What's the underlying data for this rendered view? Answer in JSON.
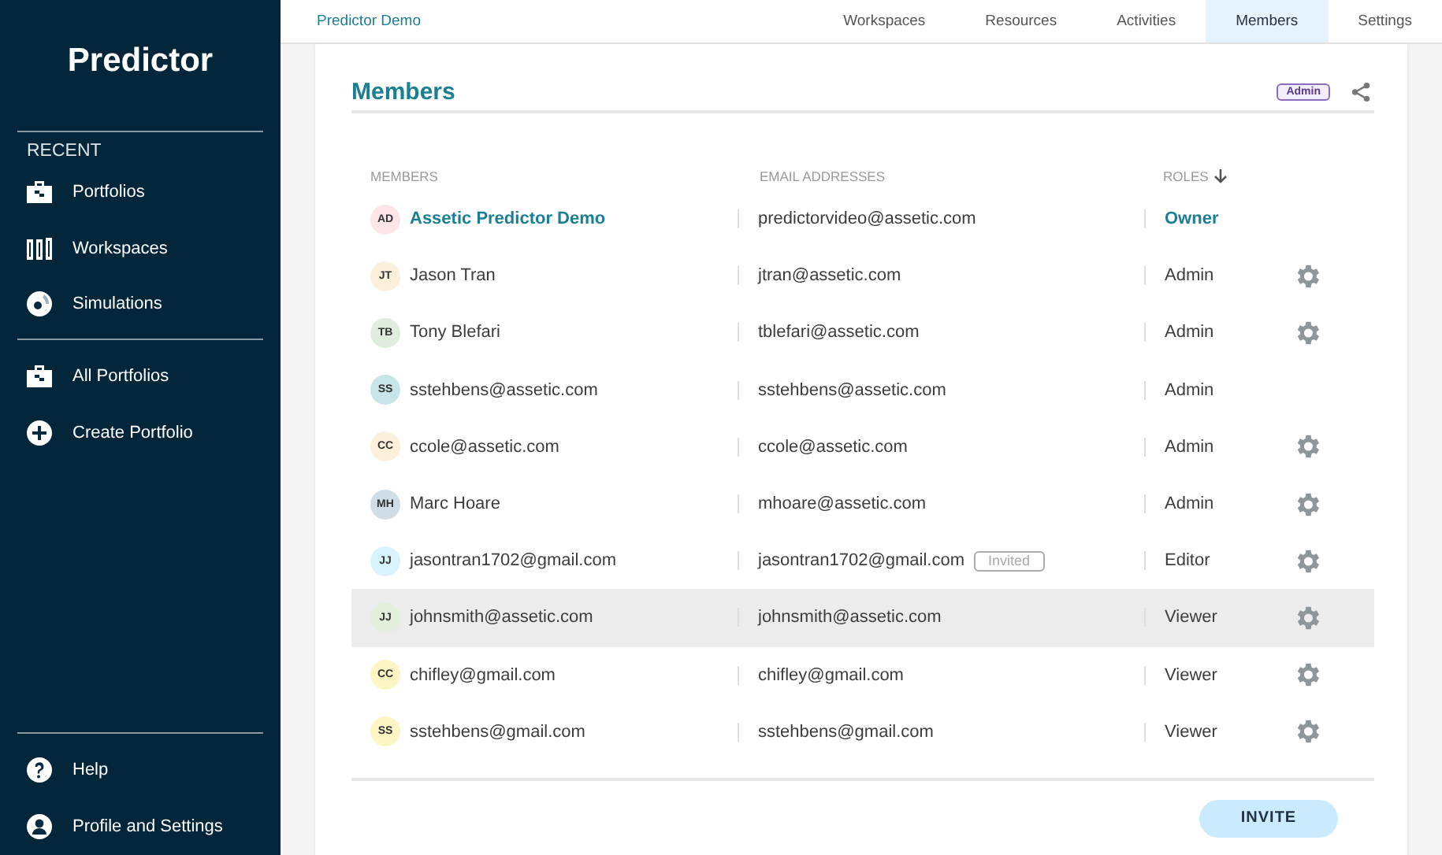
{
  "sidebar": {
    "logo": "Predictor",
    "section_label": "RECENT",
    "recent_items": [
      {
        "label": "Portfolios",
        "kind": "portfolio"
      },
      {
        "label": "Workspaces",
        "kind": "workspace"
      },
      {
        "label": "Simulations",
        "kind": "simulation"
      }
    ],
    "main_items": [
      {
        "label": "All Portfolios",
        "kind": "portfolio"
      },
      {
        "label": "Create Portfolio",
        "kind": "create"
      }
    ],
    "bottom_items": [
      {
        "label": "Help",
        "kind": "help"
      },
      {
        "label": "Profile and Settings",
        "kind": "profile"
      }
    ]
  },
  "top_bar": {
    "breadcrumb": "Predictor Demo",
    "tabs": [
      {
        "label": "Workspaces",
        "selected": false
      },
      {
        "label": "Resources",
        "selected": false
      },
      {
        "label": "Activities",
        "selected": false
      },
      {
        "label": "Members",
        "selected": true
      },
      {
        "label": "Settings",
        "selected": false
      }
    ]
  },
  "members": {
    "title": "Members",
    "badge": "Admin",
    "columns": [
      "MEMBERS",
      "EMAIL ADDRESSES",
      "ROLES"
    ],
    "rows": [
      {
        "initials": "AD",
        "color": "#fde4e6",
        "name": "Assetic Predictor Demo",
        "email": "predictorvideo@assetic.com",
        "role": "Owner",
        "owner": true,
        "settings": false,
        "highlighted": false
      },
      {
        "initials": "JT",
        "color": "#fdf0da",
        "name": "Jason Tran",
        "email": "jtran@assetic.com",
        "role": "Admin",
        "owner": false,
        "settings": true,
        "highlighted": false
      },
      {
        "initials": "TB",
        "color": "#dfeddd",
        "name": "Tony Blefari",
        "email": "tblefari@assetic.com",
        "role": "Admin",
        "owner": false,
        "settings": true,
        "highlighted": false
      },
      {
        "initials": "SS",
        "color": "#c7e4e8",
        "name": "sstehbens@assetic.com",
        "email": "sstehbens@assetic.com",
        "role": "Admin",
        "owner": false,
        "settings": false,
        "highlighted": false
      },
      {
        "initials": "CC",
        "color": "#fdf0da",
        "name": "ccole@assetic.com",
        "email": "ccole@assetic.com",
        "role": "Admin",
        "owner": false,
        "settings": true,
        "highlighted": false
      },
      {
        "initials": "MH",
        "color": "#cfdde7",
        "name": "Marc Hoare",
        "email": "mhoare@assetic.com",
        "role": "Admin",
        "owner": false,
        "settings": true,
        "highlighted": false
      },
      {
        "initials": "JJ",
        "color": "#d8f3fc",
        "name": "jasontran1702@gmail.com",
        "email": "jasontran1702@gmail.com",
        "status": "Invited",
        "role": "Editor",
        "owner": false,
        "settings": true,
        "highlighted": false
      },
      {
        "initials": "JJ",
        "color": "#e2efda",
        "name": "johnsmith@assetic.com",
        "email": "johnsmith@assetic.com",
        "role": "Viewer",
        "owner": false,
        "settings": true,
        "highlighted": true
      },
      {
        "initials": "CC",
        "color": "#fdf5c4",
        "name": "chifley@gmail.com",
        "email": "chifley@gmail.com",
        "role": "Viewer",
        "owner": false,
        "settings": true,
        "highlighted": false
      },
      {
        "initials": "SS",
        "color": "#fdf5c4",
        "name": "sstehbens@gmail.com",
        "email": "sstehbens@gmail.com",
        "role": "Viewer",
        "owner": false,
        "settings": true,
        "highlighted": false
      }
    ],
    "invite_button": "INVITE"
  }
}
